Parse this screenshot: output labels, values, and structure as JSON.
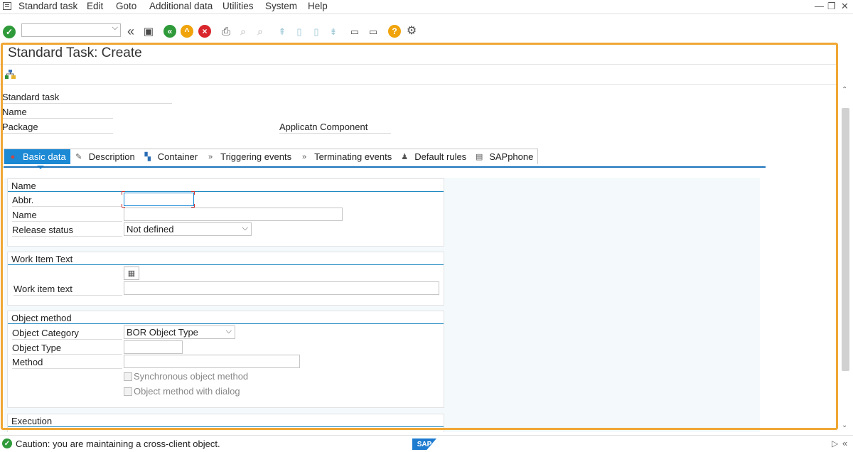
{
  "menu": {
    "items": [
      "Standard task",
      "Edit",
      "Goto",
      "Additional data",
      "Utilities",
      "System",
      "Help"
    ]
  },
  "toolbar": {
    "command_field_value": "",
    "icons": [
      "enter-icon",
      "back-double-icon",
      "save-icon",
      "back-icon",
      "exit-icon",
      "cancel-icon",
      "print-icon",
      "find-icon",
      "find-next-icon",
      "first-page-icon",
      "prev-page-icon",
      "next-page-icon",
      "last-page-icon",
      "create-session-icon",
      "shortcut-icon",
      "help-icon",
      "customize-icon"
    ]
  },
  "page": {
    "title": "Standard Task: Create"
  },
  "header": {
    "standard_task_label": "Standard task",
    "name_label": "Name",
    "package_label": "Package",
    "app_component_label": "Applicatn Component"
  },
  "tabs": [
    {
      "label": "Basic data",
      "icon": "hat-icon",
      "active": true
    },
    {
      "label": "Description",
      "icon": "edit-doc-icon",
      "active": false
    },
    {
      "label": "Container",
      "icon": "container-icon",
      "active": false
    },
    {
      "label": "Triggering events",
      "icon": "event-icon",
      "active": false
    },
    {
      "label": "Terminating events",
      "icon": "event-icon",
      "active": false
    },
    {
      "label": "Default rules",
      "icon": "person-icon",
      "active": false
    },
    {
      "label": "SAPphone",
      "icon": "phone-icon",
      "active": false
    }
  ],
  "groups": {
    "name": {
      "title": "Name",
      "abbr_label": "Abbr.",
      "abbr_value": "",
      "name_label": "Name",
      "name_value": "",
      "release_label": "Release status",
      "release_value": "Not defined"
    },
    "work_item": {
      "title": "Work Item Text",
      "text_label": "Work item text",
      "text_value": ""
    },
    "object_method": {
      "title": "Object method",
      "category_label": "Object Category",
      "category_value": "BOR Object Type",
      "type_label": "Object Type",
      "type_value": "",
      "method_label": "Method",
      "method_value": "",
      "sync_label": "Synchronous object method",
      "dialog_label": "Object method with dialog"
    },
    "execution": {
      "title": "Execution"
    }
  },
  "status": {
    "message": "Caution: you are maintaining a cross-client object.",
    "logo_text": "SAP"
  },
  "colors": {
    "highlight": "#f0a735",
    "active_tab": "#1b89d4",
    "group_line": "#1f88c1"
  }
}
